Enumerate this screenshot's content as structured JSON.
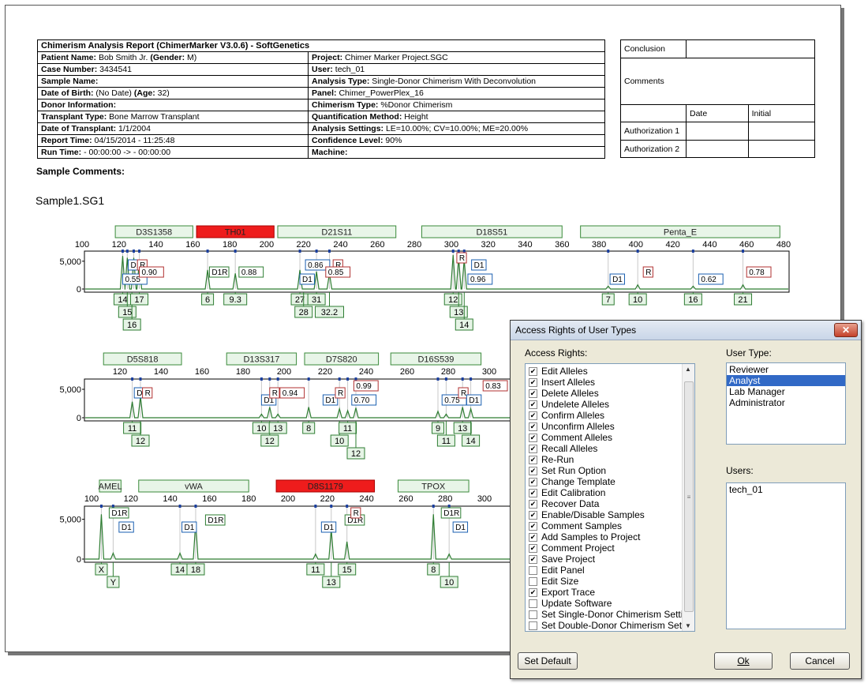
{
  "report": {
    "header_title": "Chimerism Analysis Report (ChimerMarker V3.0.6)  - SoftGenetics",
    "rows": [
      {
        "l_label": "Patient Name:",
        "l_value": "Bob Smith Jr.",
        "l_extra_label": "(Gender:",
        "l_extra_value": "M)",
        "r_label": "Project:",
        "r_value": "Chimer Marker Project.SGC"
      },
      {
        "l_label": "Case Number:",
        "l_value": "3434541",
        "r_label": "User:",
        "r_value": "tech_01"
      },
      {
        "l_label": "Sample Name:",
        "l_value": "",
        "r_label": "Analysis Type:",
        "r_value": "Single-Donor Chimerism With Deconvolution"
      },
      {
        "l_label": "Date of Birth:",
        "l_value": "(No Date)",
        "l_extra_label": "(Age:",
        "l_extra_value": "32)",
        "r_label": "Panel:",
        "r_value": "Chimer_PowerPlex_16"
      },
      {
        "l_label": "Donor Information:",
        "l_value": "",
        "r_label": "Chimerism Type:",
        "r_value": "%Donor Chimerism"
      },
      {
        "l_label": "Transplant Type:",
        "l_value": "Bone Marrow Transplant",
        "r_label": "Quantification Method:",
        "r_value": "Height"
      },
      {
        "l_label": "Date of Transplant:",
        "l_value": "1/1/2004",
        "r_label": "Analysis Settings:",
        "r_value": "LE=10.00%; CV=10.00%; ME=20.00%"
      },
      {
        "l_label": "Report Time:",
        "l_value": "04/15/2014 - 11:25:48",
        "r_label": "Confidence Level:",
        "r_value": "90%"
      },
      {
        "l_label": "Run Time:",
        "l_value": " - 00:00:00 ->  - 00:00:00",
        "r_label": "Machine:",
        "r_value": ""
      }
    ],
    "conclusion": {
      "conclusion_label": "Conclusion",
      "comments_label": "Comments",
      "date_label": "Date",
      "initial_label": "Initial",
      "auth1_label": "Authorization 1",
      "auth2_label": "Authorization 2"
    },
    "sample_comments_label": "Sample Comments:",
    "sample_name": "Sample1.SG1"
  },
  "traces": [
    {
      "yticks": [
        "5,000",
        "0"
      ],
      "axis": {
        "min": 100,
        "max": 480,
        "ticks": [
          100,
          120,
          140,
          160,
          180,
          200,
          220,
          240,
          260,
          280,
          300,
          320,
          340,
          360,
          380,
          400,
          420,
          440,
          460,
          480
        ]
      },
      "loci": [
        {
          "name": "D3S1358",
          "from": 118,
          "to": 160,
          "red": false
        },
        {
          "name": "TH01",
          "from": 162,
          "to": 204,
          "red": true
        },
        {
          "name": "D21S11",
          "from": 206,
          "to": 270,
          "red": false
        },
        {
          "name": "D18S51",
          "from": 284,
          "to": 360,
          "red": false
        },
        {
          "name": "Penta_E",
          "from": 370,
          "to": 478,
          "red": false
        }
      ],
      "peaks": [
        {
          "x": 122,
          "h": 0.95
        },
        {
          "x": 124.5,
          "h": 0.9
        },
        {
          "x": 128,
          "h": 0.9
        },
        {
          "x": 131,
          "h": 0.8
        },
        {
          "x": 168,
          "h": 0.55
        },
        {
          "x": 183,
          "h": 0.45
        },
        {
          "x": 218,
          "h": 0.55
        },
        {
          "x": 227,
          "h": 0.5
        },
        {
          "x": 234,
          "h": 0.45
        },
        {
          "x": 301,
          "h": 0.98
        },
        {
          "x": 304,
          "h": 0.9
        },
        {
          "x": 307,
          "h": 0.85
        },
        {
          "x": 385,
          "h": 0.08
        },
        {
          "x": 401,
          "h": 0.12
        },
        {
          "x": 431,
          "h": 0.08
        },
        {
          "x": 458,
          "h": 0.12
        }
      ],
      "callouts": [
        {
          "x": 122,
          "text": "0.55",
          "color": "blue",
          "row": 3
        },
        {
          "x": 125,
          "text": "D1",
          "color": "blue",
          "row": 1
        },
        {
          "x": 130,
          "text": "R",
          "color": "red",
          "row": 1
        },
        {
          "x": 131,
          "text": "0.90",
          "color": "red",
          "row": 2
        },
        {
          "x": 169,
          "text": "D1R",
          "color": "green",
          "row": 2
        },
        {
          "x": 185,
          "text": "0.88",
          "color": "green",
          "row": 2
        },
        {
          "x": 221,
          "text": "0.86",
          "color": "blue",
          "row": 1
        },
        {
          "x": 218,
          "text": "D1",
          "color": "blue",
          "row": 3
        },
        {
          "x": 236,
          "text": "R",
          "color": "red",
          "row": 1
        },
        {
          "x": 232,
          "text": "0.85",
          "color": "red",
          "row": 2
        },
        {
          "x": 303,
          "text": "R",
          "color": "red",
          "row": 0
        },
        {
          "x": 311,
          "text": "D1",
          "color": "blue",
          "row": 1
        },
        {
          "x": 309,
          "text": "0.96",
          "color": "blue",
          "row": 3
        },
        {
          "x": 386,
          "text": "D1",
          "color": "blue",
          "row": 3
        },
        {
          "x": 404,
          "text": "R",
          "color": "red",
          "row": 2
        },
        {
          "x": 434,
          "text": "0.62",
          "color": "blue",
          "row": 3
        },
        {
          "x": 460,
          "text": "0.78",
          "color": "red",
          "row": 2
        }
      ],
      "alleles": [
        {
          "x": 122,
          "label": "14",
          "level": 0
        },
        {
          "x": 124.5,
          "label": "15",
          "level": 1
        },
        {
          "x": 127,
          "label": "16",
          "level": 2
        },
        {
          "x": 131,
          "label": "17",
          "level": 0
        },
        {
          "x": 168,
          "label": "6",
          "level": 0
        },
        {
          "x": 183,
          "label": "9.3",
          "level": 0
        },
        {
          "x": 218,
          "label": "27",
          "level": 0
        },
        {
          "x": 220,
          "label": "28",
          "level": 1
        },
        {
          "x": 227,
          "label": "31",
          "level": 0
        },
        {
          "x": 234,
          "label": "32.2",
          "level": 1
        },
        {
          "x": 301,
          "label": "12",
          "level": 0
        },
        {
          "x": 304,
          "label": "13",
          "level": 1
        },
        {
          "x": 307,
          "label": "14",
          "level": 2
        },
        {
          "x": 385,
          "label": "7",
          "level": 0
        },
        {
          "x": 401,
          "label": "10",
          "level": 0
        },
        {
          "x": 431,
          "label": "16",
          "level": 0
        },
        {
          "x": 458,
          "label": "21",
          "level": 0
        }
      ]
    },
    {
      "yticks": [
        "5,000",
        "0"
      ],
      "axis": {
        "min": 100,
        "max": 300,
        "ticks": [
          120,
          140,
          160,
          180,
          200,
          220,
          240,
          260,
          280,
          300
        ]
      },
      "loci": [
        {
          "name": "D5S818",
          "from": 112,
          "to": 150,
          "red": false
        },
        {
          "name": "D13S317",
          "from": 172,
          "to": 206,
          "red": false
        },
        {
          "name": "D7S820",
          "from": 210,
          "to": 246,
          "red": false
        },
        {
          "name": "D16S539",
          "from": 252,
          "to": 296,
          "red": false
        }
      ],
      "peaks": [
        {
          "x": 126,
          "h": 0.45
        },
        {
          "x": 130,
          "h": 0.6
        },
        {
          "x": 189,
          "h": 0.1
        },
        {
          "x": 193,
          "h": 0.3
        },
        {
          "x": 197,
          "h": 0.1
        },
        {
          "x": 212,
          "h": 0.3
        },
        {
          "x": 227,
          "h": 0.25
        },
        {
          "x": 231,
          "h": 0.2
        },
        {
          "x": 235,
          "h": 0.28
        },
        {
          "x": 275,
          "h": 0.18
        },
        {
          "x": 279,
          "h": 0.1
        },
        {
          "x": 287,
          "h": 0.3
        },
        {
          "x": 291,
          "h": 0.25
        }
      ],
      "callouts": [
        {
          "x": 127,
          "text": "D1",
          "color": "blue",
          "row": 1
        },
        {
          "x": 131,
          "text": "R",
          "color": "red",
          "row": 1
        },
        {
          "x": 189,
          "text": "D1",
          "color": "blue",
          "row": 2
        },
        {
          "x": 193,
          "text": "R",
          "color": "red",
          "row": 1
        },
        {
          "x": 198,
          "text": "0.94",
          "color": "red",
          "row": 1
        },
        {
          "x": 219,
          "text": "D1",
          "color": "blue",
          "row": 2
        },
        {
          "x": 225,
          "text": "R",
          "color": "red",
          "row": 1
        },
        {
          "x": 234,
          "text": "0.99",
          "color": "red",
          "row": 0
        },
        {
          "x": 233,
          "text": "0.70",
          "color": "blue",
          "row": 2
        },
        {
          "x": 277,
          "text": "0.75",
          "color": "blue",
          "row": 2
        },
        {
          "x": 285,
          "text": "R",
          "color": "red",
          "row": 1
        },
        {
          "x": 289,
          "text": "D1",
          "color": "blue",
          "row": 2
        },
        {
          "x": 297,
          "text": "0.83",
          "color": "red",
          "row": 0
        }
      ],
      "alleles": [
        {
          "x": 126,
          "label": "11",
          "level": 0
        },
        {
          "x": 130,
          "label": "12",
          "level": 1
        },
        {
          "x": 189,
          "label": "10",
          "level": 0
        },
        {
          "x": 193,
          "label": "12",
          "level": 1
        },
        {
          "x": 197,
          "label": "13",
          "level": 0
        },
        {
          "x": 212,
          "label": "8",
          "level": 0
        },
        {
          "x": 227,
          "label": "10",
          "level": 1
        },
        {
          "x": 231,
          "label": "11",
          "level": 0
        },
        {
          "x": 235,
          "label": "12",
          "level": 2
        },
        {
          "x": 275,
          "label": "9",
          "level": 0
        },
        {
          "x": 279,
          "label": "11",
          "level": 1
        },
        {
          "x": 287,
          "label": "13",
          "level": 0
        },
        {
          "x": 291,
          "label": "14",
          "level": 1
        }
      ]
    },
    {
      "yticks": [
        "5,000",
        "0"
      ],
      "axis": {
        "min": 100,
        "max": 300,
        "ticks": [
          100,
          120,
          140,
          160,
          180,
          200,
          220,
          240,
          260,
          280,
          300
        ]
      },
      "loci": [
        {
          "name": "AMEL",
          "from": 104,
          "to": 115,
          "red": false
        },
        {
          "name": "vWA",
          "from": 124,
          "to": 180,
          "red": false
        },
        {
          "name": "D8S1179",
          "from": 194,
          "to": 244,
          "red": true
        },
        {
          "name": "TPOX",
          "from": 256,
          "to": 292,
          "red": false
        }
      ],
      "peaks": [
        {
          "x": 105,
          "h": 0.9
        },
        {
          "x": 111,
          "h": 0.12
        },
        {
          "x": 145,
          "h": 0.12
        },
        {
          "x": 153,
          "h": 0.75
        },
        {
          "x": 214,
          "h": 0.1
        },
        {
          "x": 222,
          "h": 0.6
        },
        {
          "x": 230,
          "h": 0.35
        },
        {
          "x": 274,
          "h": 0.9
        },
        {
          "x": 282,
          "h": 0.1
        }
      ],
      "callouts": [
        {
          "x": 109,
          "text": "D1R",
          "color": "green",
          "row": 0
        },
        {
          "x": 114,
          "text": "D1",
          "color": "blue",
          "row": 2
        },
        {
          "x": 146,
          "text": "D1",
          "color": "blue",
          "row": 2
        },
        {
          "x": 158,
          "text": "D1R",
          "color": "green",
          "row": 1
        },
        {
          "x": 217,
          "text": "D1",
          "color": "blue",
          "row": 2
        },
        {
          "x": 229,
          "text": "D1R",
          "color": "green",
          "row": 1
        },
        {
          "x": 232,
          "text": "R",
          "color": "red",
          "row": 0
        },
        {
          "x": 278,
          "text": "D1R",
          "color": "green",
          "row": 0
        },
        {
          "x": 284,
          "text": "D1",
          "color": "blue",
          "row": 2
        }
      ],
      "alleles": [
        {
          "x": 105,
          "label": "X",
          "level": 0
        },
        {
          "x": 111,
          "label": "Y",
          "level": 1
        },
        {
          "x": 145,
          "label": "14",
          "level": 0
        },
        {
          "x": 153,
          "label": "18",
          "level": 0
        },
        {
          "x": 214,
          "label": "11",
          "level": 0
        },
        {
          "x": 222,
          "label": "13",
          "level": 1
        },
        {
          "x": 230,
          "label": "15",
          "level": 0
        },
        {
          "x": 274,
          "label": "8",
          "level": 0
        },
        {
          "x": 282,
          "label": "10",
          "level": 1
        }
      ]
    }
  ],
  "dialog": {
    "title": "Access Rights of User Types",
    "close_glyph": "✕",
    "access_rights_label": "Access Rights:",
    "user_type_label": "User Type:",
    "users_label": "Users:",
    "access_rights": [
      {
        "label": "Edit Alleles",
        "checked": true
      },
      {
        "label": "Insert Alleles",
        "checked": true
      },
      {
        "label": "Delete Alleles",
        "checked": true
      },
      {
        "label": "Undelete Alleles",
        "checked": true
      },
      {
        "label": "Confirm Alleles",
        "checked": true
      },
      {
        "label": "Unconfirm Alleles",
        "checked": true
      },
      {
        "label": "Comment Alleles",
        "checked": true
      },
      {
        "label": "Recall Alleles",
        "checked": true
      },
      {
        "label": "Re-Run",
        "checked": true
      },
      {
        "label": "Set Run Option",
        "checked": true
      },
      {
        "label": "Change Template",
        "checked": true
      },
      {
        "label": "Edit Calibration",
        "checked": true
      },
      {
        "label": "Recover Data",
        "checked": true
      },
      {
        "label": "Enable/Disable Samples",
        "checked": true
      },
      {
        "label": "Comment Samples",
        "checked": true
      },
      {
        "label": "Add Samples to Project",
        "checked": true
      },
      {
        "label": "Comment Project",
        "checked": true
      },
      {
        "label": "Save Project",
        "checked": true
      },
      {
        "label": "Edit Panel",
        "checked": false
      },
      {
        "label": "Edit Size",
        "checked": false
      },
      {
        "label": "Export Trace",
        "checked": true
      },
      {
        "label": "Update Software",
        "checked": false
      },
      {
        "label": "Set Single-Donor Chimerism Setti",
        "checked": false
      },
      {
        "label": "Set Double-Donor Chimerism Set",
        "checked": false
      }
    ],
    "user_types": [
      "Reviewer",
      "Analyst",
      "Lab Manager",
      "Administrator"
    ],
    "selected_user_type": "Analyst",
    "users": [
      "tech_01"
    ],
    "set_default_label": "Set Default",
    "ok_label": "Ok",
    "cancel_label": "Cancel",
    "colors": {
      "selection": "#3169c6"
    }
  }
}
